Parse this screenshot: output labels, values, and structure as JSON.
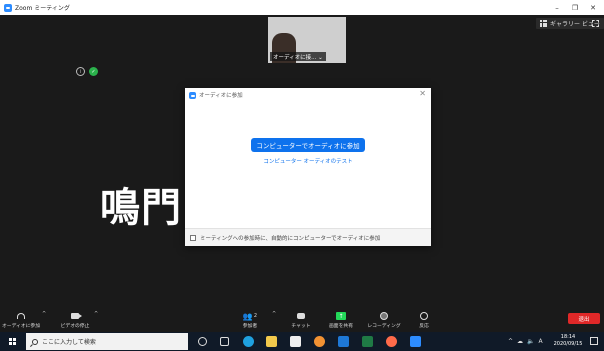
{
  "window": {
    "title": "Zoom ミーティング",
    "min": "–",
    "max": "❐",
    "close": "✕"
  },
  "meeting": {
    "gallery_view": "ギャラリー ビュー",
    "participant_label": "オーディオに接... ⌄",
    "big_text": "鳴門                  入..."
  },
  "dialog": {
    "title": "オーディオに参加",
    "close": "✕",
    "join_button": "コンピューターでオーディオに参加",
    "test_link": "コンピューター オーディオのテスト",
    "auto_join_label": "ミーティングへの参加時に、自動的にコンピューターでオーディオに参加"
  },
  "toolbar": {
    "join_audio": "オーディオに参加",
    "stop_video": "ビデオの停止",
    "participants": "参加者",
    "participants_count": "2",
    "chat": "チャット",
    "share_screen": "画面を共有",
    "record": "レコーディング",
    "reactions": "反応",
    "end": "退出"
  },
  "taskbar": {
    "search_placeholder": "ここに入力して検索",
    "ime": "A",
    "time": "18:14",
    "date": "2020/09/15"
  },
  "colors": {
    "zoom_blue": "#0e72ed",
    "share_green": "#23d959",
    "end_red": "#e02828",
    "meeting_bg": "#1a1a1a"
  }
}
